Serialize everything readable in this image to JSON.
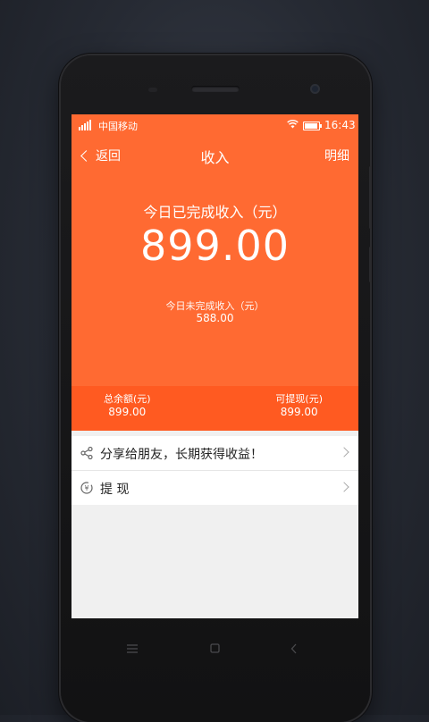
{
  "status_bar": {
    "carrier": "中国移动",
    "time": "16:43"
  },
  "nav": {
    "back_label": "返回",
    "title": "收入",
    "detail_label": "明细"
  },
  "income": {
    "today_completed_label": "今日已完成收入（元）",
    "today_completed_amount": "899.00",
    "today_pending_label": "今日未完成收入（元）",
    "today_pending_amount": "588.00"
  },
  "summary": {
    "balance_label": "总余额(元)",
    "balance_value": "899.00",
    "withdrawable_label": "可提现(元)",
    "withdrawable_value": "899.00"
  },
  "list": [
    {
      "label": "分享给朋友，长期获得收益！",
      "icon": "share-icon"
    },
    {
      "label": "提 现",
      "icon": "withdraw-icon"
    }
  ],
  "colors": {
    "accent": "#ff6a32",
    "summary_bg": "#ff5a21",
    "page_bg": "#f0f0f0"
  },
  "hardware_keys": [
    "menu-key",
    "home-key",
    "back-key"
  ]
}
